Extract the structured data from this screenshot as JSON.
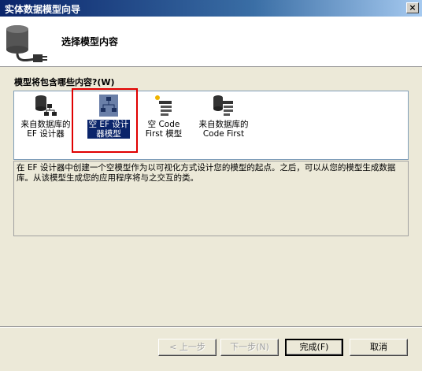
{
  "window": {
    "title": "实体数据模型向导",
    "close_glyph": "×"
  },
  "header": {
    "title": "选择模型内容",
    "icon": "database-plug-icon"
  },
  "content_prompt": "模型将包含哪些内容?(W)",
  "model_options": [
    {
      "label": "来自数据库的\nEF 设计器",
      "icon": "database-designer-icon",
      "selected": false
    },
    {
      "label": "空 EF 设计\n器模型",
      "icon": "empty-designer-model-icon",
      "selected": true
    },
    {
      "label": "空 Code\nFirst 模型",
      "icon": "empty-code-first-icon",
      "selected": false
    },
    {
      "label": "来自数据库的\nCode First",
      "icon": "database-code-first-icon",
      "selected": false
    }
  ],
  "description": "在 EF 设计器中创建一个空模型作为以可视化方式设计您的模型的起点。之后，可以从您的模型生成数据库。从该模型生成您的应用程序将与之交互的类。",
  "buttons": {
    "prev": "< 上一步",
    "next": "下一步(N)",
    "finish": "完成(F)",
    "cancel": "取消"
  },
  "colors": {
    "highlight": "#e00000",
    "selection": "#0a246a"
  }
}
